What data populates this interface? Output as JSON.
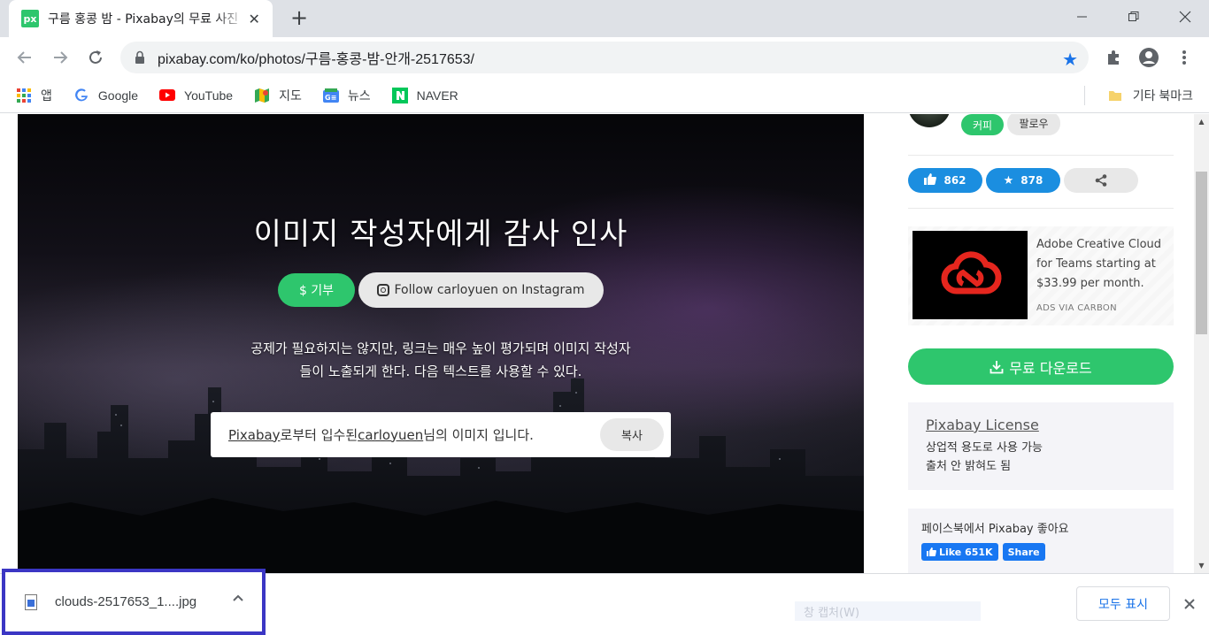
{
  "tab": {
    "favicon_text": "px",
    "title": "구름 홍콩 밤 - Pixabay의 무료 사진",
    "close_glyph": "✕",
    "new_tab_glyph": "+"
  },
  "window": {
    "minimize": "—",
    "restore": "❐",
    "close": "✕"
  },
  "toolbar": {
    "url": "pixabay.com/ko/photos/구름-홍콩-밤-안개-2517653/"
  },
  "bookmarks": {
    "items": [
      {
        "label": "앱",
        "icon": "apps-grid-icon"
      },
      {
        "label": "Google",
        "icon": "google-icon"
      },
      {
        "label": "YouTube",
        "icon": "youtube-icon"
      },
      {
        "label": "지도",
        "icon": "maps-icon"
      },
      {
        "label": "뉴스",
        "icon": "news-icon"
      },
      {
        "label": "NAVER",
        "icon": "naver-icon"
      }
    ],
    "other": "기타 북마크"
  },
  "hero": {
    "title": "이미지 작성자에게 감사 인사",
    "donate_label": "$ 기부",
    "instagram_label": "Follow carloyuen on Instagram",
    "description": "공제가 필요하지는 않지만, 링크는 매우 높이 평가되며 이미지 작성자들이 노출되게 한다. 다음 텍스트를 사용할 수 있다.",
    "attribution": {
      "link1": "Pixabay",
      "mid1": "로부터 입수된 ",
      "link2": "carloyuen",
      "mid2": "님의 이미지 입니다."
    },
    "copy_label": "복사"
  },
  "sidebar": {
    "coffee_label": "커피",
    "follow_label": "팔로우",
    "likes": "862",
    "favorites": "878",
    "ad": {
      "text": "Adobe Creative Cloud for Teams starting at $33.99 per month.",
      "via": "ADS VIA CARBON"
    },
    "download_label": "무료 다운로드",
    "license": {
      "title": "Pixabay License",
      "line1": "상업적 용도로 사용 가능",
      "line2": "출처 안 밝혀도 됨"
    },
    "facebook": {
      "text": "페이스북에서 Pixabay 좋아요",
      "like_label": "Like 651K",
      "share_label": "Share"
    }
  },
  "download_shelf": {
    "file_name": "clouds-2517653_1....jpg",
    "ghost_text": "창 캡처(W)",
    "show_all": "모두 표시"
  },
  "colors": {
    "accent_green": "#2ec66d",
    "accent_blue": "#1b8ee0",
    "chrome_blue": "#1a73e8",
    "highlight_border": "#3b36c4"
  }
}
